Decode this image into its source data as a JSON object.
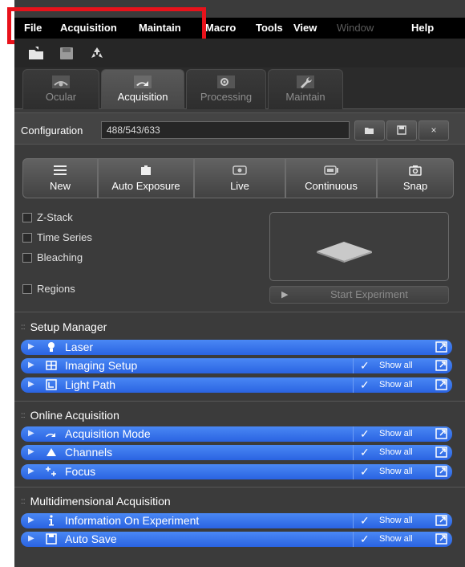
{
  "menu": {
    "items": [
      "File",
      "Acquisition",
      "Maintain",
      "Macro",
      "Tools",
      "View",
      "Window",
      "Help"
    ]
  },
  "toolbar": {
    "icons": [
      "open-folder-icon",
      "save-icon",
      "recycle-icon"
    ]
  },
  "tabs": [
    {
      "label": "Ocular",
      "icon": "eye-icon",
      "active": false
    },
    {
      "label": "Acquisition",
      "icon": "acquisition-icon",
      "active": true
    },
    {
      "label": "Processing",
      "icon": "processing-icon",
      "active": false
    },
    {
      "label": "Maintain",
      "icon": "wrench-icon",
      "active": false
    }
  ],
  "configuration": {
    "label": "Configuration",
    "value": "488/543/633",
    "buttons": [
      "open-icon",
      "save-icon",
      "×"
    ]
  },
  "actions": [
    {
      "label": "New",
      "icon": "new-lines-icon"
    },
    {
      "label": "Auto Exposure",
      "icon": "camera-icon"
    },
    {
      "label": "Live",
      "icon": "live-icon"
    },
    {
      "label": "Continuous",
      "icon": "continuous-icon"
    },
    {
      "label": "Snap",
      "icon": "snap-camera-icon"
    }
  ],
  "options": {
    "z_stack": "Z-Stack",
    "time_series": "Time Series",
    "bleaching": "Bleaching",
    "regions": "Regions"
  },
  "start_experiment": "Start Experiment",
  "sections": {
    "setup_manager": {
      "title": "Setup Manager",
      "tools": [
        {
          "label": "Laser",
          "show_all": ""
        },
        {
          "label": "Imaging Setup",
          "show_all": "Show all"
        },
        {
          "label": "Light Path",
          "show_all": "Show all"
        }
      ]
    },
    "online_acquisition": {
      "title": "Online Acquisition",
      "tools": [
        {
          "label": "Acquisition Mode",
          "show_all": "Show all"
        },
        {
          "label": "Channels",
          "show_all": "Show all"
        },
        {
          "label": "Focus",
          "show_all": "Show all"
        }
      ]
    },
    "multidimensional": {
      "title": "Multidimensional Acquisition",
      "tools": [
        {
          "label": "Information On Experiment",
          "show_all": "Show all"
        },
        {
          "label": "Auto Save",
          "show_all": "Show all"
        }
      ]
    }
  },
  "colors": {
    "tool_row_blue": "#2f6ae6",
    "highlight_red": "#e8121b",
    "panel_bg": "#3b3b3b"
  }
}
